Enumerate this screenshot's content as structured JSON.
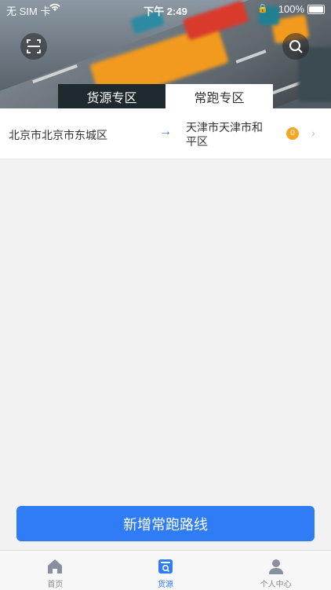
{
  "status_bar": {
    "carrier": "无 SIM 卡",
    "time": "下午 2:49",
    "battery": "100%"
  },
  "header": {
    "scan_icon": "scan-icon",
    "search_icon": "search-icon"
  },
  "tabs": [
    {
      "label": "货源专区",
      "active": false
    },
    {
      "label": "常跑专区",
      "active": true
    }
  ],
  "routes": [
    {
      "from": "北京市北京市东城区",
      "to": "天津市天津市和平区",
      "count": "0"
    }
  ],
  "add_button": {
    "label": "新增常跑路线"
  },
  "bottom_nav": [
    {
      "label": "首页",
      "icon": "home-icon",
      "active": false
    },
    {
      "label": "货源",
      "icon": "cargo-icon",
      "active": true
    },
    {
      "label": "个人中心",
      "icon": "user-icon",
      "active": false
    }
  ],
  "colors": {
    "accent": "#2f7cf6",
    "badge": "#f5a623",
    "tab_inactive_bg": "#1f2a2f"
  }
}
